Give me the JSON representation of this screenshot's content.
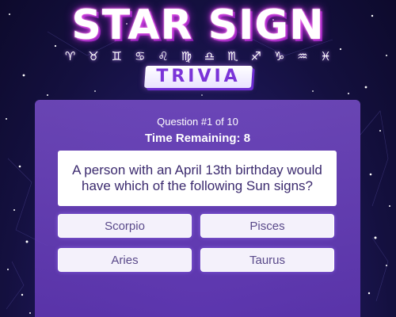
{
  "header": {
    "title": "STAR SIGN",
    "subtitle": "TRIVIA",
    "zodiac_symbols": [
      "♈",
      "♉",
      "♊",
      "♋",
      "♌",
      "♍",
      "♎",
      "♏",
      "♐",
      "♑",
      "♒",
      "♓"
    ]
  },
  "quiz": {
    "question_counter": "Question #1 of 10",
    "timer_text": "Time Remaining: 8",
    "question": "A person with an April 13th birthday would have which of the following Sun signs?",
    "answers": [
      "Scorpio",
      "Pisces",
      "Aries",
      "Taurus"
    ]
  },
  "colors": {
    "background": "#14103f",
    "panel": "#6a3db8",
    "title_glow": "#e04ce0",
    "trivia_text": "#7b34d8",
    "question_text": "#3b2a6e"
  }
}
